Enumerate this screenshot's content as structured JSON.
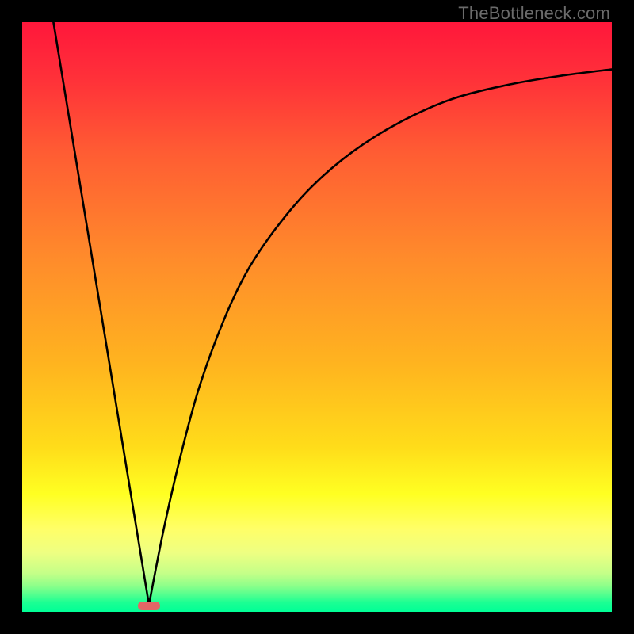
{
  "watermark": "TheBottleneck.com",
  "chart_data": {
    "type": "line",
    "title": "",
    "xlabel": "",
    "ylabel": "",
    "xlim": [
      0,
      100
    ],
    "ylim": [
      0,
      100
    ],
    "background_gradient": {
      "stops": [
        {
          "pct": 0.0,
          "color": "#ff173b"
        },
        {
          "pct": 0.1,
          "color": "#ff3239"
        },
        {
          "pct": 0.22,
          "color": "#ff5c33"
        },
        {
          "pct": 0.4,
          "color": "#ff8b2b"
        },
        {
          "pct": 0.58,
          "color": "#ffb41f"
        },
        {
          "pct": 0.72,
          "color": "#ffdc1a"
        },
        {
          "pct": 0.8,
          "color": "#ffff22"
        },
        {
          "pct": 0.86,
          "color": "#ffff68"
        },
        {
          "pct": 0.9,
          "color": "#eeff82"
        },
        {
          "pct": 0.935,
          "color": "#c4ff88"
        },
        {
          "pct": 0.956,
          "color": "#8dff8a"
        },
        {
          "pct": 0.972,
          "color": "#4fff8f"
        },
        {
          "pct": 0.984,
          "color": "#1cff93"
        },
        {
          "pct": 1.0,
          "color": "#00ff96"
        }
      ]
    },
    "curve": {
      "description": "V-shaped bottleneck curve: steep linear drop to a minimum near x≈21, then an asymptotic rise approaching ~92 at the right edge.",
      "min_x": 21.5,
      "min_y": 1.2,
      "left_branch": [
        {
          "x": 5.3,
          "y": 100
        },
        {
          "x": 21.5,
          "y": 1.2
        }
      ],
      "right_branch": [
        {
          "x": 21.5,
          "y": 1.2
        },
        {
          "x": 24,
          "y": 14
        },
        {
          "x": 27,
          "y": 27
        },
        {
          "x": 30,
          "y": 38
        },
        {
          "x": 34,
          "y": 49
        },
        {
          "x": 38,
          "y": 57.5
        },
        {
          "x": 43,
          "y": 65
        },
        {
          "x": 49,
          "y": 72
        },
        {
          "x": 56,
          "y": 78
        },
        {
          "x": 64,
          "y": 83
        },
        {
          "x": 73,
          "y": 87
        },
        {
          "x": 83,
          "y": 89.5
        },
        {
          "x": 92,
          "y": 91
        },
        {
          "x": 100,
          "y": 92
        }
      ]
    },
    "marker": {
      "x": 21.5,
      "y": 1.0,
      "color": "#e36666",
      "shape": "pill"
    }
  }
}
